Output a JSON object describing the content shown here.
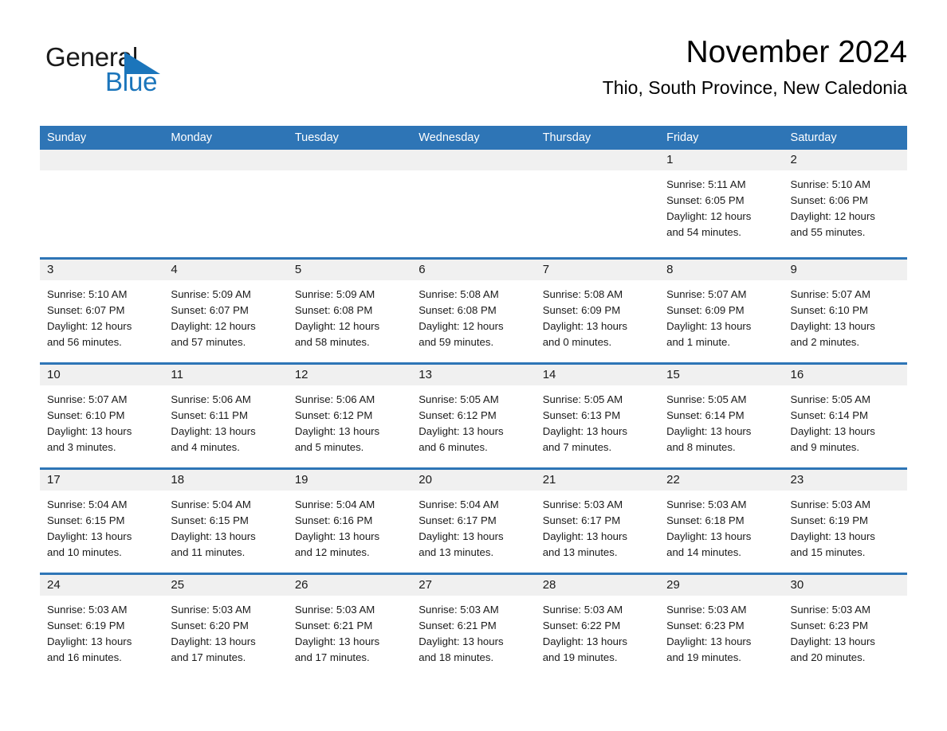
{
  "brand": {
    "line1": "General",
    "line2": "Blue",
    "triangle_color": "#1b75bb",
    "logo_icon": "general-blue-logo"
  },
  "header": {
    "title": "November 2024",
    "subtitle": "Thio, South Province, New Caledonia"
  },
  "theme": {
    "header_blue": "#2e75b6",
    "day_band_gray": "#f0f0f0",
    "text": "#1a1a1a",
    "background": "#ffffff"
  },
  "weekdays": [
    "Sunday",
    "Monday",
    "Tuesday",
    "Wednesday",
    "Thursday",
    "Friday",
    "Saturday"
  ],
  "weeks": [
    [
      {
        "day": "",
        "empty": true,
        "lines": []
      },
      {
        "day": "",
        "empty": true,
        "lines": []
      },
      {
        "day": "",
        "empty": true,
        "lines": []
      },
      {
        "day": "",
        "empty": true,
        "lines": []
      },
      {
        "day": "",
        "empty": true,
        "lines": []
      },
      {
        "day": "1",
        "empty": false,
        "lines": [
          "Sunrise: 5:11 AM",
          "Sunset: 6:05 PM",
          "Daylight: 12 hours",
          "and 54 minutes."
        ]
      },
      {
        "day": "2",
        "empty": false,
        "lines": [
          "Sunrise: 5:10 AM",
          "Sunset: 6:06 PM",
          "Daylight: 12 hours",
          "and 55 minutes."
        ]
      }
    ],
    [
      {
        "day": "3",
        "empty": false,
        "lines": [
          "Sunrise: 5:10 AM",
          "Sunset: 6:07 PM",
          "Daylight: 12 hours",
          "and 56 minutes."
        ]
      },
      {
        "day": "4",
        "empty": false,
        "lines": [
          "Sunrise: 5:09 AM",
          "Sunset: 6:07 PM",
          "Daylight: 12 hours",
          "and 57 minutes."
        ]
      },
      {
        "day": "5",
        "empty": false,
        "lines": [
          "Sunrise: 5:09 AM",
          "Sunset: 6:08 PM",
          "Daylight: 12 hours",
          "and 58 minutes."
        ]
      },
      {
        "day": "6",
        "empty": false,
        "lines": [
          "Sunrise: 5:08 AM",
          "Sunset: 6:08 PM",
          "Daylight: 12 hours",
          "and 59 minutes."
        ]
      },
      {
        "day": "7",
        "empty": false,
        "lines": [
          "Sunrise: 5:08 AM",
          "Sunset: 6:09 PM",
          "Daylight: 13 hours",
          "and 0 minutes."
        ]
      },
      {
        "day": "8",
        "empty": false,
        "lines": [
          "Sunrise: 5:07 AM",
          "Sunset: 6:09 PM",
          "Daylight: 13 hours",
          "and 1 minute."
        ]
      },
      {
        "day": "9",
        "empty": false,
        "lines": [
          "Sunrise: 5:07 AM",
          "Sunset: 6:10 PM",
          "Daylight: 13 hours",
          "and 2 minutes."
        ]
      }
    ],
    [
      {
        "day": "10",
        "empty": false,
        "lines": [
          "Sunrise: 5:07 AM",
          "Sunset: 6:10 PM",
          "Daylight: 13 hours",
          "and 3 minutes."
        ]
      },
      {
        "day": "11",
        "empty": false,
        "lines": [
          "Sunrise: 5:06 AM",
          "Sunset: 6:11 PM",
          "Daylight: 13 hours",
          "and 4 minutes."
        ]
      },
      {
        "day": "12",
        "empty": false,
        "lines": [
          "Sunrise: 5:06 AM",
          "Sunset: 6:12 PM",
          "Daylight: 13 hours",
          "and 5 minutes."
        ]
      },
      {
        "day": "13",
        "empty": false,
        "lines": [
          "Sunrise: 5:05 AM",
          "Sunset: 6:12 PM",
          "Daylight: 13 hours",
          "and 6 minutes."
        ]
      },
      {
        "day": "14",
        "empty": false,
        "lines": [
          "Sunrise: 5:05 AM",
          "Sunset: 6:13 PM",
          "Daylight: 13 hours",
          "and 7 minutes."
        ]
      },
      {
        "day": "15",
        "empty": false,
        "lines": [
          "Sunrise: 5:05 AM",
          "Sunset: 6:14 PM",
          "Daylight: 13 hours",
          "and 8 minutes."
        ]
      },
      {
        "day": "16",
        "empty": false,
        "lines": [
          "Sunrise: 5:05 AM",
          "Sunset: 6:14 PM",
          "Daylight: 13 hours",
          "and 9 minutes."
        ]
      }
    ],
    [
      {
        "day": "17",
        "empty": false,
        "lines": [
          "Sunrise: 5:04 AM",
          "Sunset: 6:15 PM",
          "Daylight: 13 hours",
          "and 10 minutes."
        ]
      },
      {
        "day": "18",
        "empty": false,
        "lines": [
          "Sunrise: 5:04 AM",
          "Sunset: 6:15 PM",
          "Daylight: 13 hours",
          "and 11 minutes."
        ]
      },
      {
        "day": "19",
        "empty": false,
        "lines": [
          "Sunrise: 5:04 AM",
          "Sunset: 6:16 PM",
          "Daylight: 13 hours",
          "and 12 minutes."
        ]
      },
      {
        "day": "20",
        "empty": false,
        "lines": [
          "Sunrise: 5:04 AM",
          "Sunset: 6:17 PM",
          "Daylight: 13 hours",
          "and 13 minutes."
        ]
      },
      {
        "day": "21",
        "empty": false,
        "lines": [
          "Sunrise: 5:03 AM",
          "Sunset: 6:17 PM",
          "Daylight: 13 hours",
          "and 13 minutes."
        ]
      },
      {
        "day": "22",
        "empty": false,
        "lines": [
          "Sunrise: 5:03 AM",
          "Sunset: 6:18 PM",
          "Daylight: 13 hours",
          "and 14 minutes."
        ]
      },
      {
        "day": "23",
        "empty": false,
        "lines": [
          "Sunrise: 5:03 AM",
          "Sunset: 6:19 PM",
          "Daylight: 13 hours",
          "and 15 minutes."
        ]
      }
    ],
    [
      {
        "day": "24",
        "empty": false,
        "lines": [
          "Sunrise: 5:03 AM",
          "Sunset: 6:19 PM",
          "Daylight: 13 hours",
          "and 16 minutes."
        ]
      },
      {
        "day": "25",
        "empty": false,
        "lines": [
          "Sunrise: 5:03 AM",
          "Sunset: 6:20 PM",
          "Daylight: 13 hours",
          "and 17 minutes."
        ]
      },
      {
        "day": "26",
        "empty": false,
        "lines": [
          "Sunrise: 5:03 AM",
          "Sunset: 6:21 PM",
          "Daylight: 13 hours",
          "and 17 minutes."
        ]
      },
      {
        "day": "27",
        "empty": false,
        "lines": [
          "Sunrise: 5:03 AM",
          "Sunset: 6:21 PM",
          "Daylight: 13 hours",
          "and 18 minutes."
        ]
      },
      {
        "day": "28",
        "empty": false,
        "lines": [
          "Sunrise: 5:03 AM",
          "Sunset: 6:22 PM",
          "Daylight: 13 hours",
          "and 19 minutes."
        ]
      },
      {
        "day": "29",
        "empty": false,
        "lines": [
          "Sunrise: 5:03 AM",
          "Sunset: 6:23 PM",
          "Daylight: 13 hours",
          "and 19 minutes."
        ]
      },
      {
        "day": "30",
        "empty": false,
        "lines": [
          "Sunrise: 5:03 AM",
          "Sunset: 6:23 PM",
          "Daylight: 13 hours",
          "and 20 minutes."
        ]
      }
    ]
  ]
}
